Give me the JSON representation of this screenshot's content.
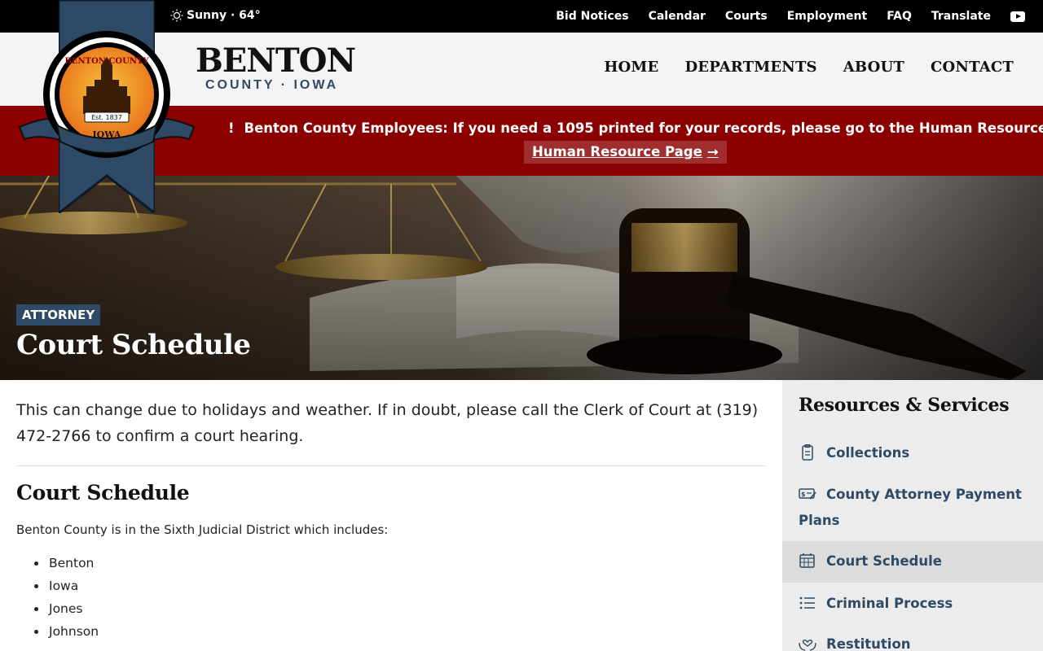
{
  "weather": {
    "text": "Sunny · 64°"
  },
  "util_nav": [
    "Bid Notices",
    "Calendar",
    "Courts",
    "Employment",
    "FAQ",
    "Translate"
  ],
  "brand": {
    "name": "BENTON",
    "subtitle": "COUNTY · IOWA",
    "seal_top": "BENTON COUNTY",
    "seal_est": "Est. 1837",
    "seal_bottom": "IOWA"
  },
  "main_nav": [
    "HOME",
    "DEPARTMENTS",
    "ABOUT",
    "CONTACT"
  ],
  "alert": {
    "icon": "!",
    "message": "Benton County Employees: If you need a 1095 printed for your records, please go to the Human Resource Page.",
    "link_label": "Human Resource Page",
    "link_arrow": "→"
  },
  "hero": {
    "breadcrumb": "ATTORNEY",
    "title": "Court Schedule"
  },
  "content": {
    "intro": "This can change due to holidays and weather. If in doubt, please call the Clerk of Court at (319) 472-2766 to confirm a court hearing.",
    "heading": "Court Schedule",
    "description": "Benton County is in the Sixth Judicial District which includes:",
    "counties": [
      "Benton",
      "Iowa",
      "Jones",
      "Johnson"
    ]
  },
  "sidebar": {
    "title": "Resources & Services",
    "items": [
      {
        "label": "Collections",
        "icon": "clipboard-icon"
      },
      {
        "label": "County Attorney Payment Plans",
        "icon": "payment-check-icon"
      },
      {
        "label": "Court Schedule",
        "icon": "calendar-icon",
        "active": true
      },
      {
        "label": "Criminal Process",
        "icon": "list-icon"
      },
      {
        "label": "Restitution",
        "icon": "hands-heart-icon"
      }
    ]
  },
  "colors": {
    "navy": "#2f4a66",
    "alert_red": "#8b0000",
    "black": "#000000",
    "header_bg": "#f4f4f4"
  }
}
